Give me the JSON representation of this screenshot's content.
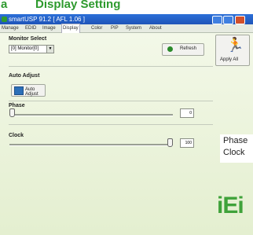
{
  "heading": {
    "prefix": "a",
    "text": "Display Setting"
  },
  "window": {
    "title": "smartUSP 91.2 [ AFL 1.06 ]"
  },
  "tabs": [
    {
      "label": "Manage"
    },
    {
      "label": "EDID"
    },
    {
      "label": "Image"
    },
    {
      "label": "Display"
    },
    {
      "label": "Color"
    },
    {
      "label": "PIP"
    },
    {
      "label": "System"
    },
    {
      "label": "About"
    }
  ],
  "monitor_select": {
    "label": "Monitor Select",
    "selected": "[0] Monitor[0]",
    "refresh_label": "Refresh",
    "apply_label": "Apply All"
  },
  "auto_adjust": {
    "label": "Auto Adjust",
    "button_label": "Auto Adjust"
  },
  "phase": {
    "label": "Phase",
    "value": "0",
    "level": 0
  },
  "clock": {
    "label": "Clock",
    "value": "100",
    "level": 1
  },
  "legend": {
    "line1": "Phase",
    "line2": "Clock"
  },
  "logo": {
    "text": "iEi"
  },
  "colors": {
    "accent_green": "#2e9a2e",
    "titlebar_blue": "#1f54b8"
  }
}
